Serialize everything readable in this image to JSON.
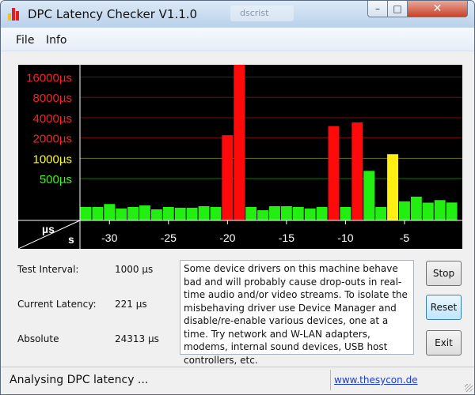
{
  "window": {
    "title": "DPC Latency Checker V1.1.0",
    "background_tab": "dscrist"
  },
  "titlebar_buttons": {
    "minimize": "–",
    "maximize": "□",
    "close": "✕"
  },
  "menu": {
    "items": [
      "File",
      "Info"
    ]
  },
  "chart_data": {
    "type": "bar",
    "title": "",
    "x_tick_labels": [
      "-30",
      "-25",
      "-20",
      "-15",
      "-10",
      "-5"
    ],
    "x_ticks": [
      -30,
      -25,
      -20,
      -15,
      -10,
      -5
    ],
    "xlim": [
      -32.5,
      -0.1
    ],
    "x_unit_label": "s",
    "y_unit_label": "µs",
    "y_scale": "log",
    "y_ticks": [
      {
        "label": "16000µs",
        "value": 16000,
        "color": "#ff2020"
      },
      {
        "label": "8000µs",
        "value": 8000,
        "color": "#ff2020"
      },
      {
        "label": "4000µs",
        "value": 4000,
        "color": "#ff2020"
      },
      {
        "label": "2000µs",
        "value": 2000,
        "color": "#ff2020"
      },
      {
        "label": "1000µs",
        "value": 1000,
        "color": "#ffff00"
      },
      {
        "label": "500µs",
        "value": 500,
        "color": "#33ff00"
      }
    ],
    "ylim": [
      120,
      24313
    ],
    "bars": [
      {
        "x": -32,
        "value": 190,
        "color": "green"
      },
      {
        "x": -31,
        "value": 190,
        "color": "green"
      },
      {
        "x": -30,
        "value": 210,
        "color": "green"
      },
      {
        "x": -29,
        "value": 180,
        "color": "green"
      },
      {
        "x": -28,
        "value": 190,
        "color": "green"
      },
      {
        "x": -27,
        "value": 200,
        "color": "green"
      },
      {
        "x": -26,
        "value": 175,
        "color": "green"
      },
      {
        "x": -25,
        "value": 190,
        "color": "green"
      },
      {
        "x": -24,
        "value": 185,
        "color": "green"
      },
      {
        "x": -23,
        "value": 185,
        "color": "green"
      },
      {
        "x": -22,
        "value": 195,
        "color": "green"
      },
      {
        "x": -21,
        "value": 190,
        "color": "green"
      },
      {
        "x": -20,
        "value": 2200,
        "color": "red"
      },
      {
        "x": -19,
        "value": 24313,
        "color": "red"
      },
      {
        "x": -18,
        "value": 190,
        "color": "green"
      },
      {
        "x": -17,
        "value": 170,
        "color": "green"
      },
      {
        "x": -16,
        "value": 195,
        "color": "green"
      },
      {
        "x": -15,
        "value": 195,
        "color": "green"
      },
      {
        "x": -14,
        "value": 190,
        "color": "green"
      },
      {
        "x": -13,
        "value": 180,
        "color": "green"
      },
      {
        "x": -12,
        "value": 190,
        "color": "green"
      },
      {
        "x": -11,
        "value": 3000,
        "color": "red"
      },
      {
        "x": -10,
        "value": 190,
        "color": "green"
      },
      {
        "x": -9,
        "value": 3400,
        "color": "red"
      },
      {
        "x": -8,
        "value": 650,
        "color": "green"
      },
      {
        "x": -7,
        "value": 190,
        "color": "green"
      },
      {
        "x": -6,
        "value": 1150,
        "color": "yellow"
      },
      {
        "x": -5,
        "value": 230,
        "color": "green"
      },
      {
        "x": -4,
        "value": 270,
        "color": "green"
      },
      {
        "x": -3,
        "value": 220,
        "color": "green"
      },
      {
        "x": -2,
        "value": 240,
        "color": "green"
      },
      {
        "x": -1,
        "value": 221,
        "color": "green"
      }
    ]
  },
  "colors": {
    "plot_bg": "#000000",
    "grid": "#4a4a4a",
    "bar_green": "#22ee11",
    "bar_red": "#ff0a0a",
    "bar_yellow": "#ffee11",
    "axis_text": "#ffffff"
  },
  "info": {
    "test_interval_label": "Test Interval:",
    "test_interval_value": "1000 µs",
    "current_latency_label": "Current Latency:",
    "current_latency_value": "221 µs",
    "absolute_label": "Absolute",
    "absolute_value": "24313 µs"
  },
  "message": "Some device drivers on this machine behave bad and will probably cause drop-outs in real-time audio and/or video streams. To isolate the misbehaving driver use Device Manager and disable/re-enable various devices, one at a time. Try network and W-LAN adapters, modems, internal sound devices, USB host controllers, etc.",
  "buttons": {
    "stop": "Stop",
    "reset": "Reset",
    "exit": "Exit"
  },
  "status": {
    "text": "Analysing DPC latency ...",
    "link": "www.thesycon.de"
  }
}
